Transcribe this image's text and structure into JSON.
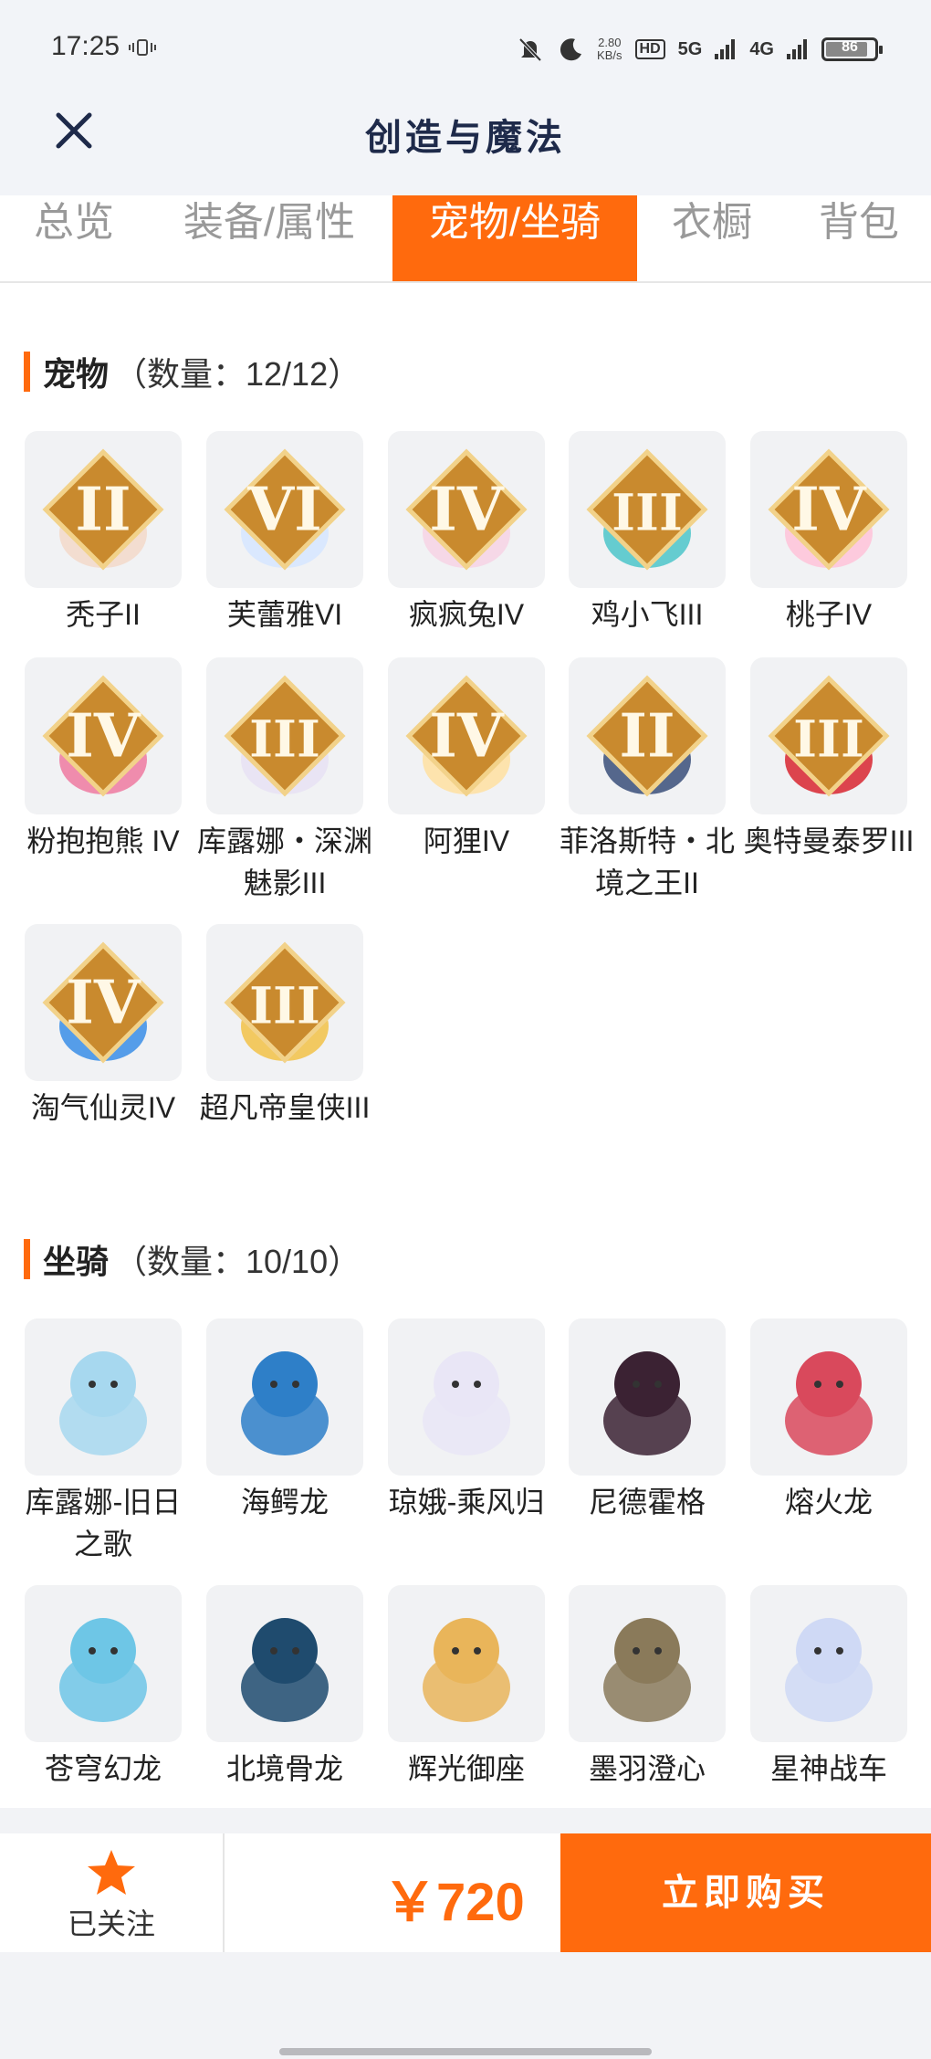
{
  "status": {
    "time": "17:25",
    "speed_value": "2.80",
    "speed_unit": "KB/s",
    "hd": "HD",
    "net1": "5G",
    "net2": "4G",
    "battery": "86"
  },
  "header": {
    "title": "创造与魔法"
  },
  "tabs": [
    {
      "label": "总览",
      "active": false
    },
    {
      "label": "装备/属性",
      "active": false
    },
    {
      "label": "宠物/坐骑",
      "active": true
    },
    {
      "label": "衣橱",
      "active": false
    },
    {
      "label": "背包",
      "active": false
    }
  ],
  "pets": {
    "name": "宠物",
    "count": "（数量：12/12）",
    "items": [
      {
        "label": "秃子II",
        "tier": "II",
        "icon": "bald-head-pet-icon",
        "color": "#f3d9c9"
      },
      {
        "label": "芙蕾雅VI",
        "tier": "VI",
        "icon": "valkyrie-pet-icon",
        "color": "#d6e6ff"
      },
      {
        "label": "疯疯兔IV",
        "tier": "IV",
        "icon": "pink-rabbit-pet-icon",
        "color": "#f7d4e4"
      },
      {
        "label": "鸡小飞III",
        "tier": "III",
        "icon": "muscle-chick-pet-icon",
        "color": "#4cc5c9"
      },
      {
        "label": "桃子IV",
        "tier": "IV",
        "icon": "peach-cat-pet-icon",
        "color": "#ffc3d8"
      },
      {
        "label": "粉抱抱熊 IV",
        "tier": "IV",
        "icon": "pink-bear-pet-icon",
        "color": "#ef7aa0"
      },
      {
        "label": "库露娜・深渊魅影III",
        "tier": "III",
        "icon": "kuluna-pet-icon",
        "color": "#e7e2f3"
      },
      {
        "label": "阿狸IV",
        "tier": "IV",
        "icon": "fox-lion-pet-icon",
        "color": "#ffe1a0"
      },
      {
        "label": "菲洛斯特・北境之王II",
        "tier": "II",
        "icon": "north-king-pet-icon",
        "color": "#3a4f79"
      },
      {
        "label": "奥特曼泰罗III",
        "tier": "III",
        "icon": "ultraman-pet-icon",
        "color": "#d8262f"
      },
      {
        "label": "淘气仙灵IV",
        "tier": "IV",
        "icon": "blue-dog-pet-icon",
        "color": "#3a8ee6"
      },
      {
        "label": "超凡帝皇侠III",
        "tier": "III",
        "icon": "golden-hero-pet-icon",
        "color": "#f2c247"
      }
    ]
  },
  "mounts": {
    "name": "坐骑",
    "count": "（数量：10/10）",
    "items": [
      {
        "label": "库露娜-旧日之歌",
        "icon": "kuluna-song-mount-icon",
        "color": "#a7d8ef"
      },
      {
        "label": "海鳄龙",
        "icon": "sea-dragon-mount-icon",
        "color": "#2e7fc8"
      },
      {
        "label": "琼娥-乘风归",
        "icon": "qiong-e-mount-icon",
        "color": "#e9e6f6"
      },
      {
        "label": "尼德霍格",
        "icon": "nidhogg-mount-icon",
        "color": "#3b2233"
      },
      {
        "label": "熔火龙",
        "icon": "lava-dragon-mount-icon",
        "color": "#d9495c"
      },
      {
        "label": "苍穹幻龙",
        "icon": "sky-dragon-mount-icon",
        "color": "#6ec6e6"
      },
      {
        "label": "北境骨龙",
        "icon": "bone-dragon-mount-icon",
        "color": "#1f4b6e"
      },
      {
        "label": "辉光御座",
        "icon": "glow-throne-mount-icon",
        "color": "#e9b55a"
      },
      {
        "label": "墨羽澄心",
        "icon": "ink-feather-mount-icon",
        "color": "#8a7a5a"
      },
      {
        "label": "星神战车",
        "icon": "star-chariot-mount-icon",
        "color": "#cfd9f5"
      }
    ]
  },
  "footer": {
    "follow_label": "已关注",
    "price": "￥720",
    "buy_label": "立即购买"
  },
  "colors": {
    "accent": "#ff6a0d"
  }
}
